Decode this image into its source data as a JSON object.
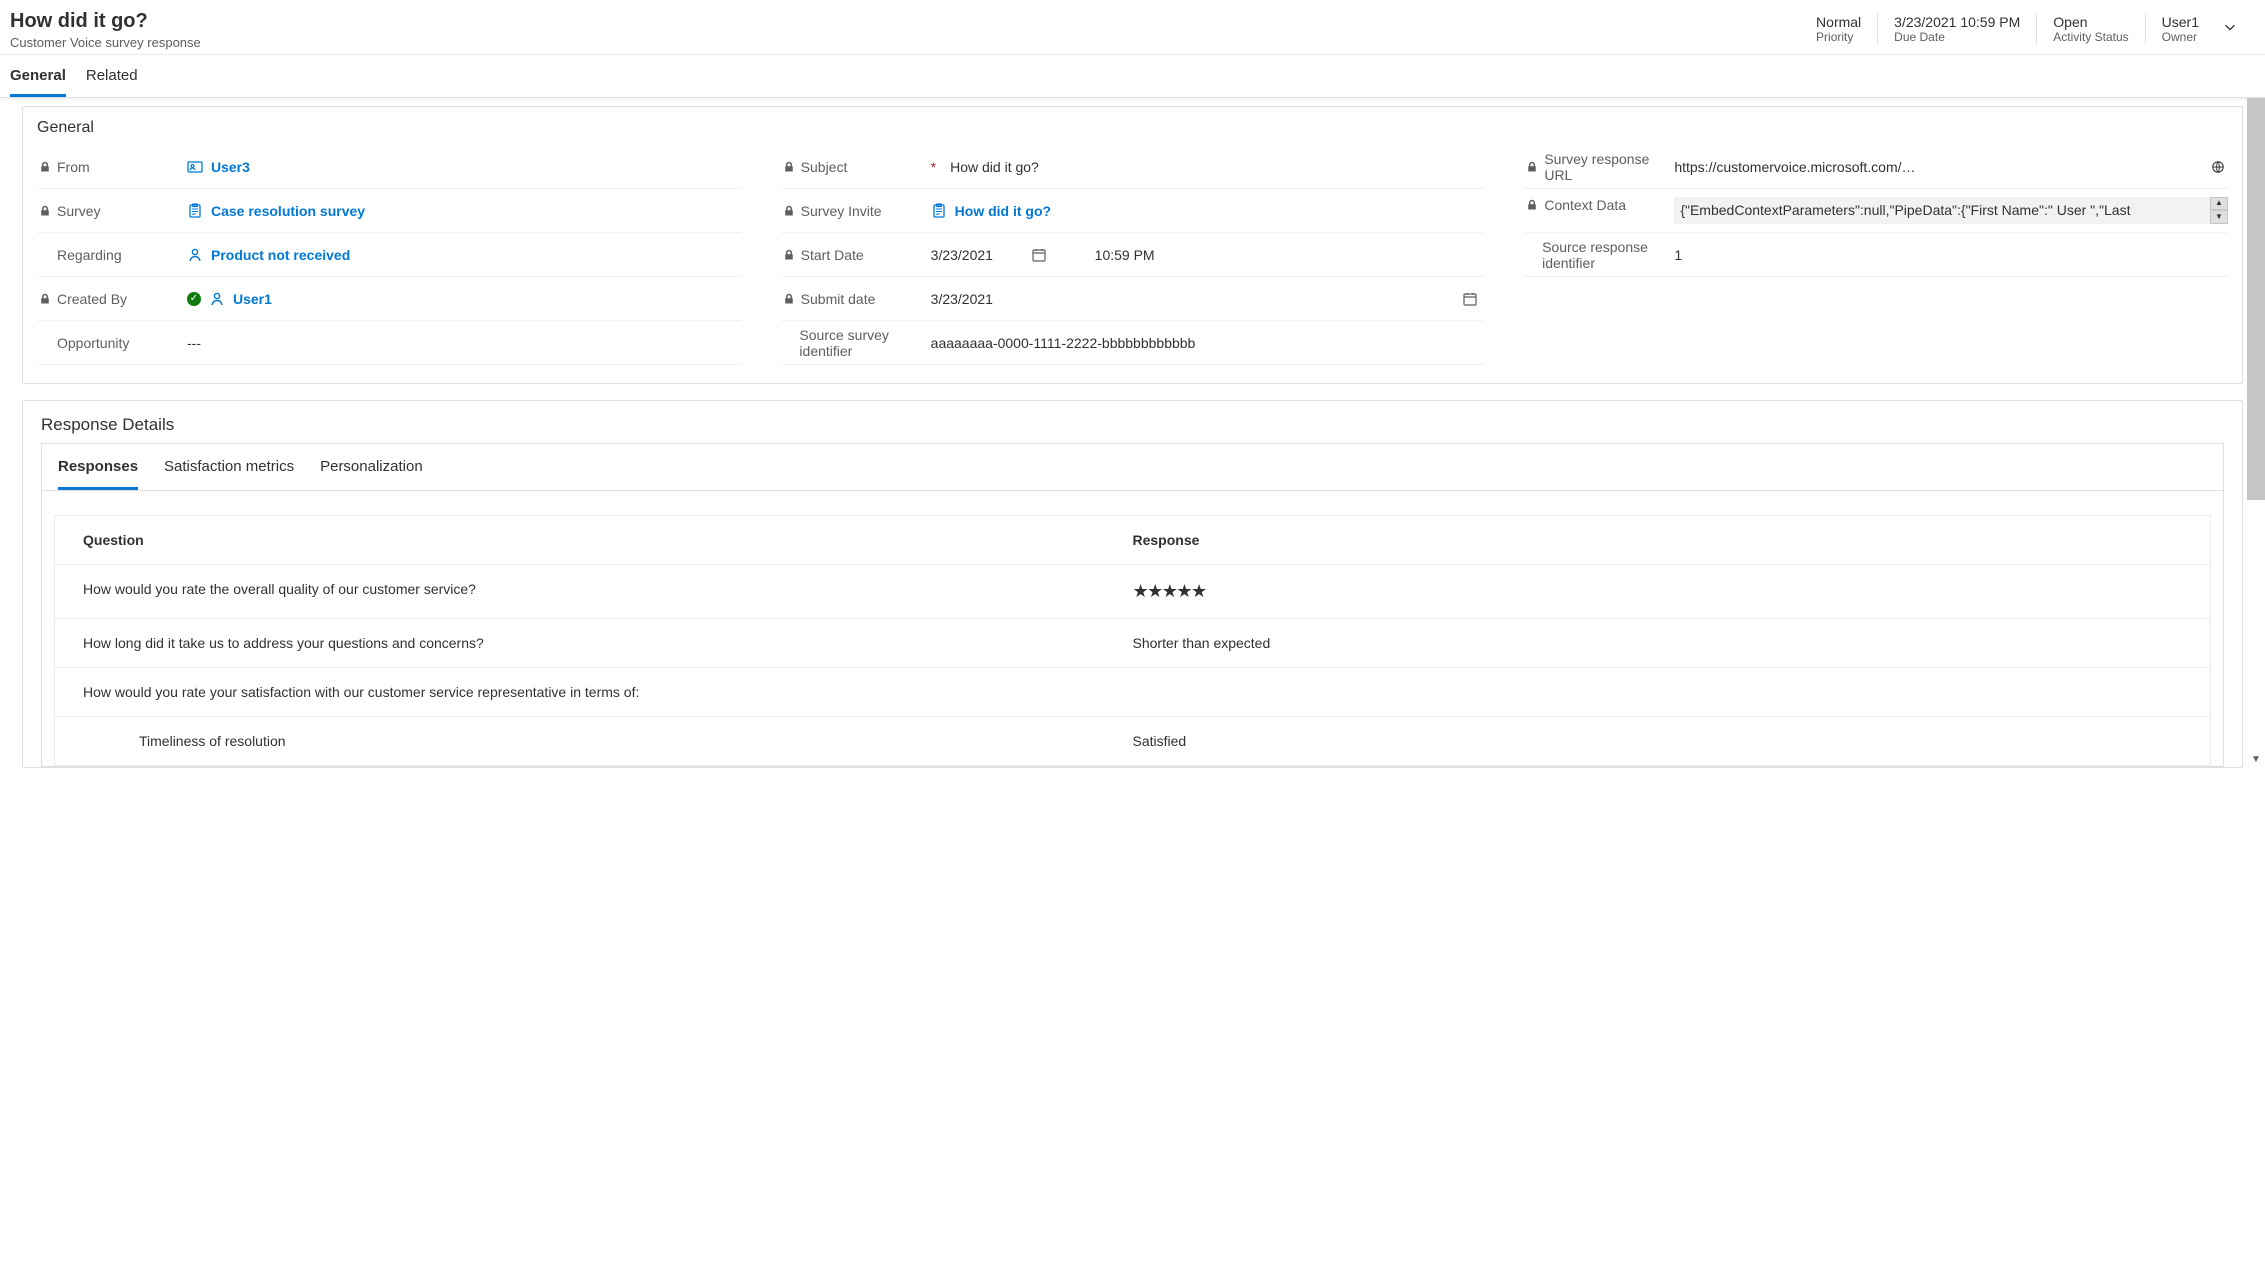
{
  "header": {
    "title": "How did it go?",
    "subtitle": "Customer Voice survey response",
    "stats": {
      "priority": {
        "value": "Normal",
        "label": "Priority"
      },
      "dueDate": {
        "value": "3/23/2021 10:59 PM",
        "label": "Due Date"
      },
      "status": {
        "value": "Open",
        "label": "Activity Status"
      },
      "owner": {
        "value": "User1",
        "label": "Owner"
      }
    }
  },
  "tabs": {
    "general": "General",
    "related": "Related"
  },
  "general": {
    "section_title": "General",
    "from_label": "From",
    "from_value": "User3",
    "survey_label": "Survey",
    "survey_value": "Case resolution survey",
    "regarding_label": "Regarding",
    "regarding_value": "Product not received",
    "createdby_label": "Created By",
    "createdby_value": "User1",
    "opportunity_label": "Opportunity",
    "opportunity_value": "---",
    "subject_label": "Subject",
    "subject_value": "How did it go?",
    "invite_label": "Survey Invite",
    "invite_value": "How did it go?",
    "startdate_label": "Start Date",
    "startdate_value": "3/23/2021",
    "starttime_value": "10:59 PM",
    "submitdate_label": "Submit date",
    "submitdate_value": "3/23/2021",
    "sourceid_label": "Source survey identifier",
    "sourceid_value": "aaaaaaaa-0000-1111-2222-bbbbbbbbbbbb",
    "url_label": "Survey response URL",
    "url_value": "https://customervoice.microsoft.com/Pages...",
    "context_label": "Context Data",
    "context_value": "{\"EmbedContextParameters\":null,\"PipeData\":{\"First Name\":\" User \",\"Last",
    "respid_label": "Source response identifier",
    "respid_value": "1"
  },
  "details": {
    "section_title": "Response Details",
    "tabs": {
      "responses": "Responses",
      "satisfaction": "Satisfaction metrics",
      "personalization": "Personalization"
    },
    "table": {
      "col_question": "Question",
      "col_response": "Response",
      "rows": [
        {
          "q": "How would you rate the overall quality of our customer service?",
          "a_type": "stars",
          "a": "★★★★★"
        },
        {
          "q": "How long did it take us to address your questions and concerns?",
          "a_type": "text",
          "a": "Shorter than expected"
        },
        {
          "q": "How would you rate your satisfaction with our customer service representative in terms of:",
          "a_type": "none",
          "a": ""
        },
        {
          "q": "Timeliness of resolution",
          "a_type": "text",
          "a": "Satisfied",
          "indent": true
        }
      ]
    }
  }
}
